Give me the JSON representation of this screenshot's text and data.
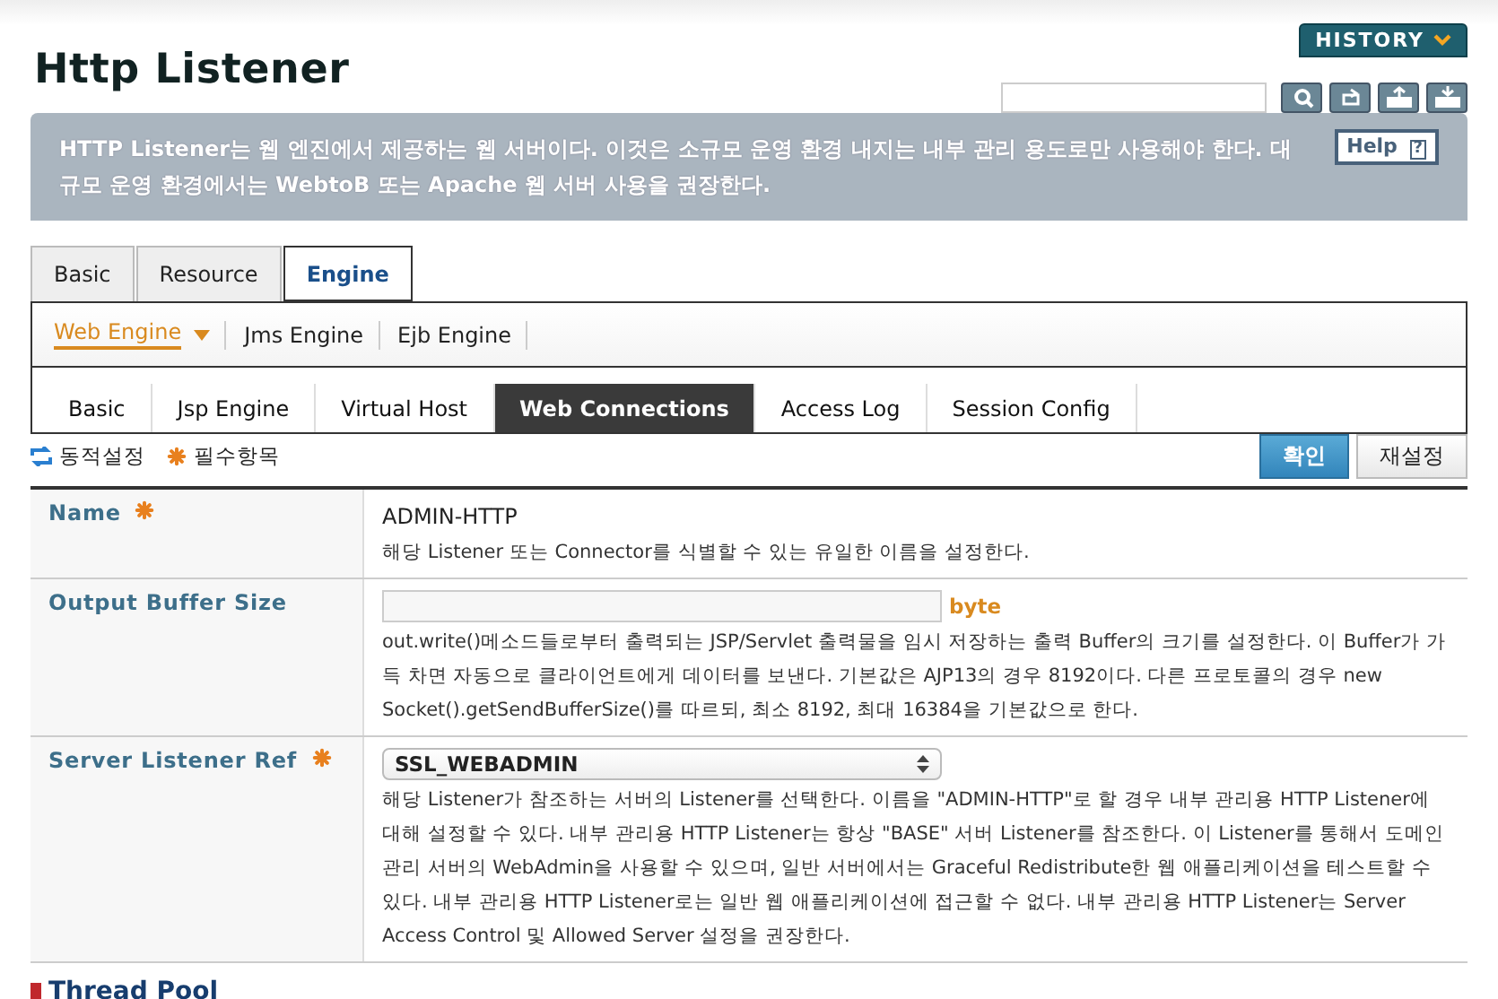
{
  "header": {
    "title": "Http Listener",
    "history_button": "HISTORY"
  },
  "banner": {
    "text": "HTTP Listener는 웹 엔진에서 제공하는 웹 서버이다. 이것은 소규모 운영 환경 내지는 내부 관리 용도로만 사용해야 한다. 대규모 운영 환경에서는 WebtoB 또는 Apache 웹 서버 사용을 권장한다.",
    "help_button": "Help",
    "help_mark": "?"
  },
  "tabs": [
    {
      "label": "Basic",
      "selected": false
    },
    {
      "label": "Resource",
      "selected": false
    },
    {
      "label": "Engine",
      "selected": true
    }
  ],
  "engine_tabs": [
    {
      "label": "Web Engine",
      "selected": true
    },
    {
      "label": "Jms Engine",
      "selected": false
    },
    {
      "label": "Ejb Engine",
      "selected": false
    }
  ],
  "sub_tabs": [
    {
      "label": "Basic",
      "selected": false
    },
    {
      "label": "Jsp Engine",
      "selected": false
    },
    {
      "label": "Virtual Host",
      "selected": false
    },
    {
      "label": "Web Connections",
      "selected": true
    },
    {
      "label": "Access Log",
      "selected": false
    },
    {
      "label": "Session Config",
      "selected": false
    }
  ],
  "legend": [
    {
      "kind": "dynamic",
      "label": "동적설정"
    },
    {
      "kind": "required",
      "label": "필수항목"
    }
  ],
  "buttons": [
    {
      "label": "확인",
      "kind": "primary"
    },
    {
      "label": "재설정",
      "kind": "secondary"
    }
  ],
  "fields": [
    {
      "label": "Name",
      "required": true,
      "kind": "text",
      "value": "ADMIN-HTTP",
      "description": "해당 Listener 또는 Connector를 식별할 수 있는 유일한 이름을 설정한다."
    },
    {
      "label": "Output Buffer Size",
      "required": false,
      "kind": "input",
      "unit": "byte",
      "description": "out.write()메소드들로부터 출력되는 JSP/Servlet 출력물을 임시 저장하는 출력 Buffer의 크기를 설정한다. 이 Buffer가 가득 차면 자동으로 클라이언트에게 데이터를 보낸다. 기본값은 AJP13의 경우 8192이다. 다른 프로토콜의 경우 new Socket().getSendBufferSize()를 따르되, 최소 8192, 최대 16384을 기본값으로 한다."
    },
    {
      "label": "Server Listener Ref",
      "required": true,
      "kind": "select",
      "value": "SSL_WEBADMIN",
      "description": "해당 Listener가 참조하는 서버의 Listener를 선택한다. 이름을 \"ADMIN-HTTP\"로 할 경우 내부 관리용 HTTP Listener에 대해 설정할 수 있다. 내부 관리용 HTTP Listener는 항상 \"BASE\" 서버 Listener를 참조한다. 이 Listener를 통해서 도메인 관리 서버의 WebAdmin을 사용할 수 있으며, 일반 서버에서는 Graceful Redistribute한 웹 애플리케이션을 테스트할 수 있다. 내부 관리용 HTTP Listener로는 일반 웹 애플리케이션에 접근할 수 없다. 내부 관리용 HTTP Listener는 Server Access Control 및 Allowed Server 설정을 권장한다."
    }
  ],
  "section_heading": "Thread Pool"
}
